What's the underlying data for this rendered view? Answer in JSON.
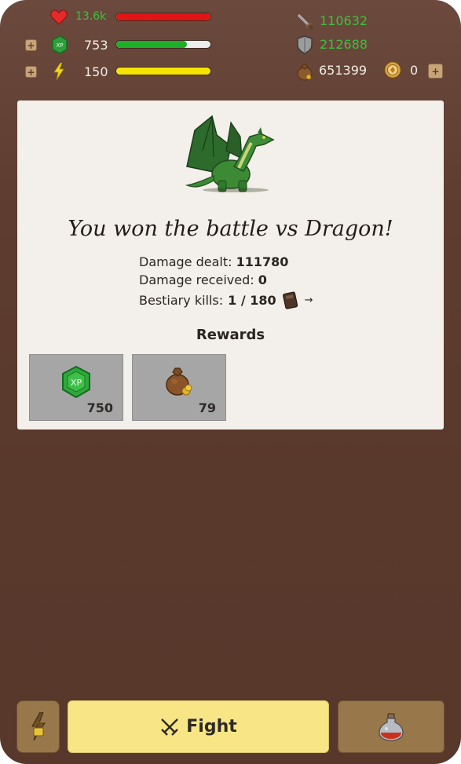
{
  "stats": {
    "hp": {
      "value": "13.6k",
      "fill": 1.0,
      "color": "#e01515"
    },
    "xp": {
      "value": "753",
      "fill": 0.75,
      "color": "#1fae2a"
    },
    "energy": {
      "value": "150",
      "fill": 1.0,
      "color": "#f5e400"
    },
    "attack": {
      "value": "110632"
    },
    "defense": {
      "value": "212688"
    },
    "gold": {
      "value": "651399"
    },
    "tokens": {
      "value": "0"
    }
  },
  "battle": {
    "title": "You won the battle vs Dragon!",
    "damage_dealt_label": "Damage dealt:",
    "damage_dealt": "111780",
    "damage_received_label": "Damage received:",
    "damage_received": "0",
    "bestiary_label": "Bestiary kills:",
    "bestiary": "1 / 180",
    "arrow": "→",
    "xp_badge_text": "XP"
  },
  "rewards": {
    "heading": "Rewards",
    "items": [
      {
        "name": "xp",
        "value": "750"
      },
      {
        "name": "gold",
        "value": "79"
      }
    ]
  },
  "bottom": {
    "fight_label": "Fight"
  },
  "colors": {
    "background": "#5e3d30",
    "card": "#f3efea",
    "fight_button": "#f8e686",
    "side_button": "#98784a",
    "stat_green": "#3fbf3f"
  }
}
